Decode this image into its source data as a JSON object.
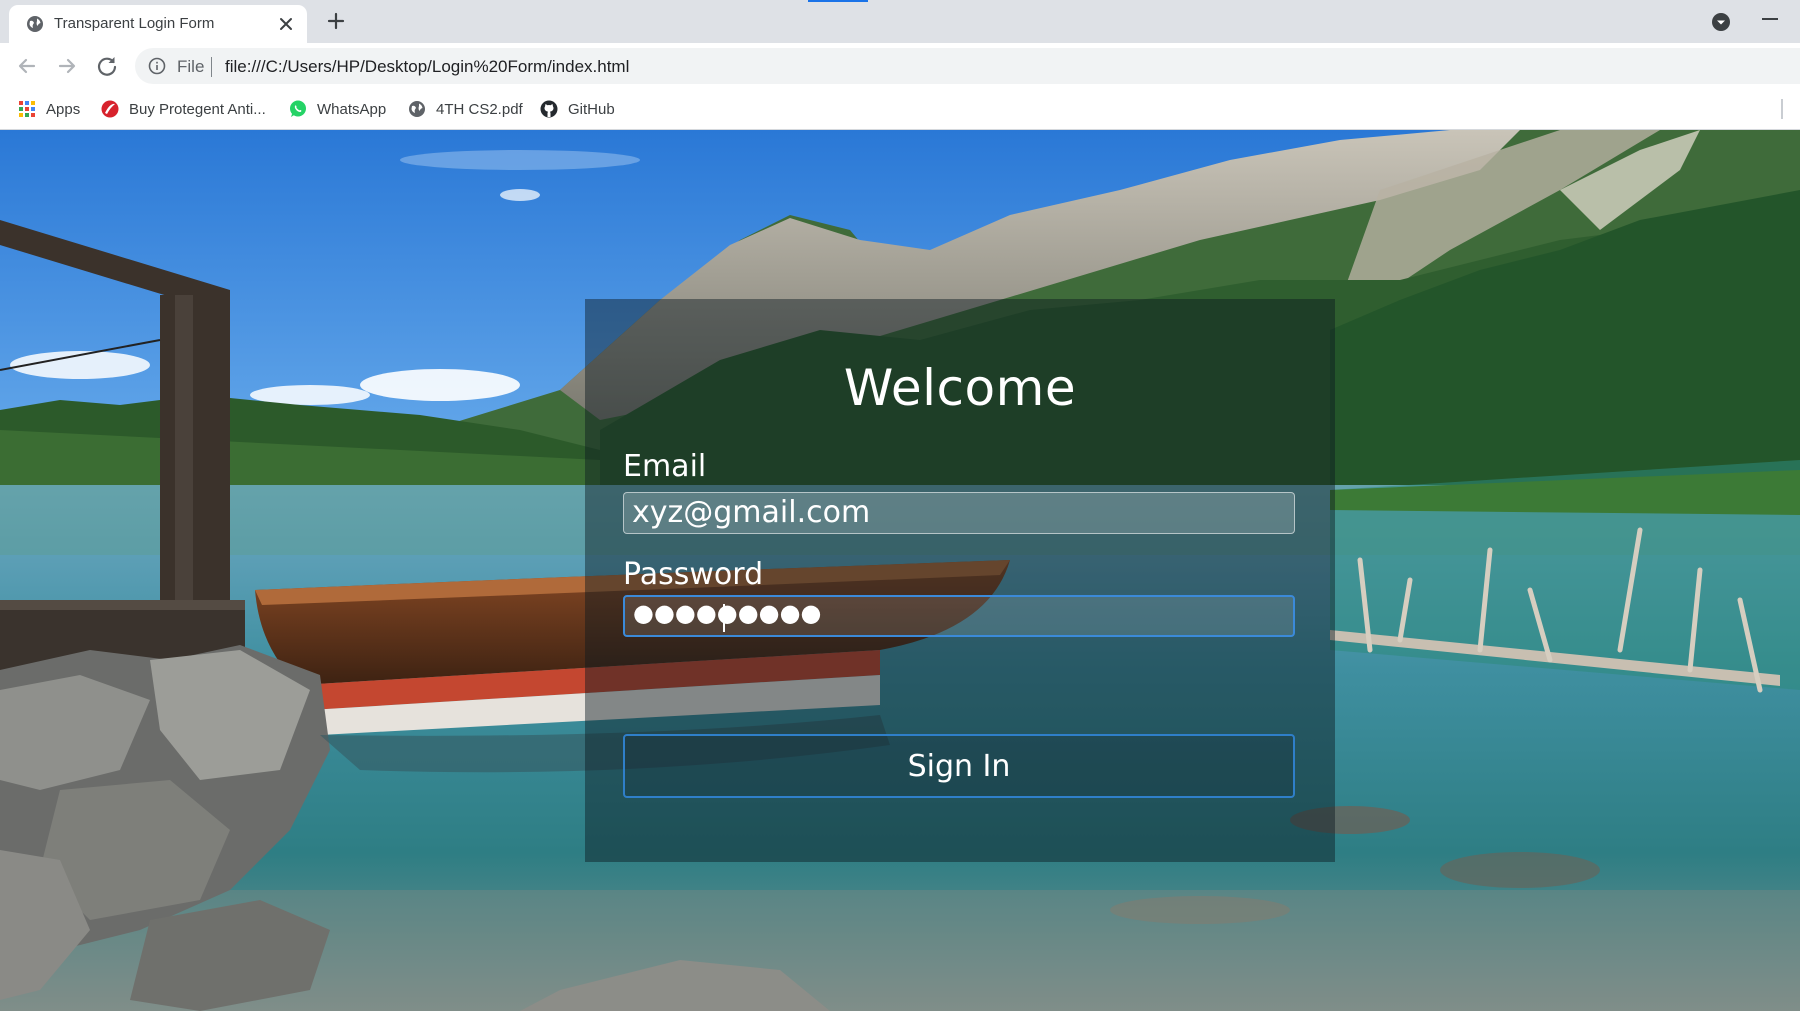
{
  "browser": {
    "tab_title": "Transparent Login Form",
    "address_scheme": "File",
    "url": "file:///C:/Users/HP/Desktop/Login%20Form/index.html",
    "bookmarks": [
      {
        "label": "Apps",
        "icon": "apps-grid-icon"
      },
      {
        "label": "Buy Protegent Anti...",
        "icon": "protegent-icon"
      },
      {
        "label": "WhatsApp",
        "icon": "whatsapp-icon"
      },
      {
        "label": "4TH CS2.pdf",
        "icon": "globe-icon"
      },
      {
        "label": "GitHub",
        "icon": "github-icon"
      }
    ]
  },
  "login": {
    "title": "Welcome",
    "email_label": "Email",
    "email_value": "xyz@gmail.com",
    "password_label": "Password",
    "password_masked": "●●●●●●●●●",
    "submit_label": "Sign In"
  },
  "colors": {
    "focus_border": "#3b8ad9",
    "card_overlay": "rgba(10,24,30,0.45)",
    "chrome_bg": "#dee1e6"
  }
}
